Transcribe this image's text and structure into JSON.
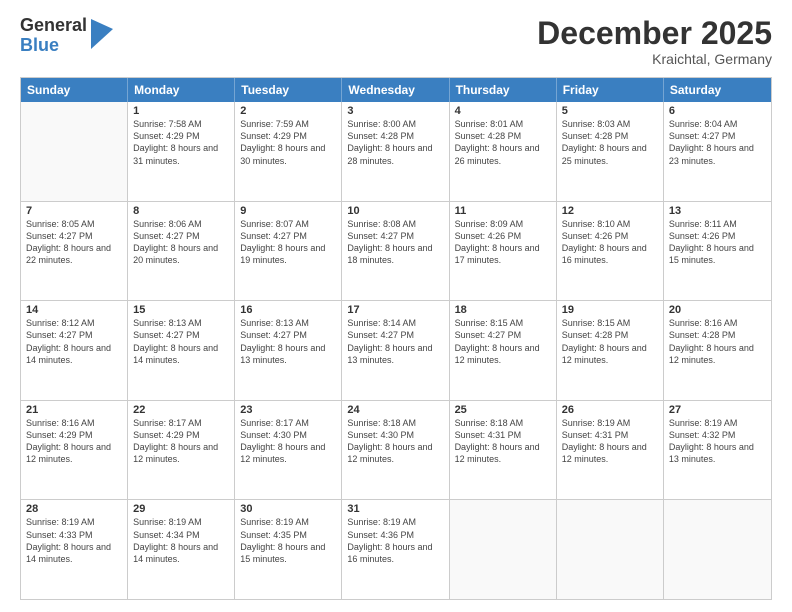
{
  "logo": {
    "general": "General",
    "blue": "Blue"
  },
  "header": {
    "month": "December 2025",
    "location": "Kraichtal, Germany"
  },
  "weekdays": [
    "Sunday",
    "Monday",
    "Tuesday",
    "Wednesday",
    "Thursday",
    "Friday",
    "Saturday"
  ],
  "weeks": [
    [
      {
        "day": "",
        "empty": true
      },
      {
        "day": "1",
        "sunrise": "7:58 AM",
        "sunset": "4:29 PM",
        "daylight": "8 hours and 31 minutes."
      },
      {
        "day": "2",
        "sunrise": "7:59 AM",
        "sunset": "4:29 PM",
        "daylight": "8 hours and 30 minutes."
      },
      {
        "day": "3",
        "sunrise": "8:00 AM",
        "sunset": "4:28 PM",
        "daylight": "8 hours and 28 minutes."
      },
      {
        "day": "4",
        "sunrise": "8:01 AM",
        "sunset": "4:28 PM",
        "daylight": "8 hours and 26 minutes."
      },
      {
        "day": "5",
        "sunrise": "8:03 AM",
        "sunset": "4:28 PM",
        "daylight": "8 hours and 25 minutes."
      },
      {
        "day": "6",
        "sunrise": "8:04 AM",
        "sunset": "4:27 PM",
        "daylight": "8 hours and 23 minutes."
      }
    ],
    [
      {
        "day": "7",
        "sunrise": "8:05 AM",
        "sunset": "4:27 PM",
        "daylight": "8 hours and 22 minutes."
      },
      {
        "day": "8",
        "sunrise": "8:06 AM",
        "sunset": "4:27 PM",
        "daylight": "8 hours and 20 minutes."
      },
      {
        "day": "9",
        "sunrise": "8:07 AM",
        "sunset": "4:27 PM",
        "daylight": "8 hours and 19 minutes."
      },
      {
        "day": "10",
        "sunrise": "8:08 AM",
        "sunset": "4:27 PM",
        "daylight": "8 hours and 18 minutes."
      },
      {
        "day": "11",
        "sunrise": "8:09 AM",
        "sunset": "4:26 PM",
        "daylight": "8 hours and 17 minutes."
      },
      {
        "day": "12",
        "sunrise": "8:10 AM",
        "sunset": "4:26 PM",
        "daylight": "8 hours and 16 minutes."
      },
      {
        "day": "13",
        "sunrise": "8:11 AM",
        "sunset": "4:26 PM",
        "daylight": "8 hours and 15 minutes."
      }
    ],
    [
      {
        "day": "14",
        "sunrise": "8:12 AM",
        "sunset": "4:27 PM",
        "daylight": "8 hours and 14 minutes."
      },
      {
        "day": "15",
        "sunrise": "8:13 AM",
        "sunset": "4:27 PM",
        "daylight": "8 hours and 14 minutes."
      },
      {
        "day": "16",
        "sunrise": "8:13 AM",
        "sunset": "4:27 PM",
        "daylight": "8 hours and 13 minutes."
      },
      {
        "day": "17",
        "sunrise": "8:14 AM",
        "sunset": "4:27 PM",
        "daylight": "8 hours and 13 minutes."
      },
      {
        "day": "18",
        "sunrise": "8:15 AM",
        "sunset": "4:27 PM",
        "daylight": "8 hours and 12 minutes."
      },
      {
        "day": "19",
        "sunrise": "8:15 AM",
        "sunset": "4:28 PM",
        "daylight": "8 hours and 12 minutes."
      },
      {
        "day": "20",
        "sunrise": "8:16 AM",
        "sunset": "4:28 PM",
        "daylight": "8 hours and 12 minutes."
      }
    ],
    [
      {
        "day": "21",
        "sunrise": "8:16 AM",
        "sunset": "4:29 PM",
        "daylight": "8 hours and 12 minutes."
      },
      {
        "day": "22",
        "sunrise": "8:17 AM",
        "sunset": "4:29 PM",
        "daylight": "8 hours and 12 minutes."
      },
      {
        "day": "23",
        "sunrise": "8:17 AM",
        "sunset": "4:30 PM",
        "daylight": "8 hours and 12 minutes."
      },
      {
        "day": "24",
        "sunrise": "8:18 AM",
        "sunset": "4:30 PM",
        "daylight": "8 hours and 12 minutes."
      },
      {
        "day": "25",
        "sunrise": "8:18 AM",
        "sunset": "4:31 PM",
        "daylight": "8 hours and 12 minutes."
      },
      {
        "day": "26",
        "sunrise": "8:19 AM",
        "sunset": "4:31 PM",
        "daylight": "8 hours and 12 minutes."
      },
      {
        "day": "27",
        "sunrise": "8:19 AM",
        "sunset": "4:32 PM",
        "daylight": "8 hours and 13 minutes."
      }
    ],
    [
      {
        "day": "28",
        "sunrise": "8:19 AM",
        "sunset": "4:33 PM",
        "daylight": "8 hours and 14 minutes."
      },
      {
        "day": "29",
        "sunrise": "8:19 AM",
        "sunset": "4:34 PM",
        "daylight": "8 hours and 14 minutes."
      },
      {
        "day": "30",
        "sunrise": "8:19 AM",
        "sunset": "4:35 PM",
        "daylight": "8 hours and 15 minutes."
      },
      {
        "day": "31",
        "sunrise": "8:19 AM",
        "sunset": "4:36 PM",
        "daylight": "8 hours and 16 minutes."
      },
      {
        "day": "",
        "empty": true
      },
      {
        "day": "",
        "empty": true
      },
      {
        "day": "",
        "empty": true
      }
    ]
  ]
}
